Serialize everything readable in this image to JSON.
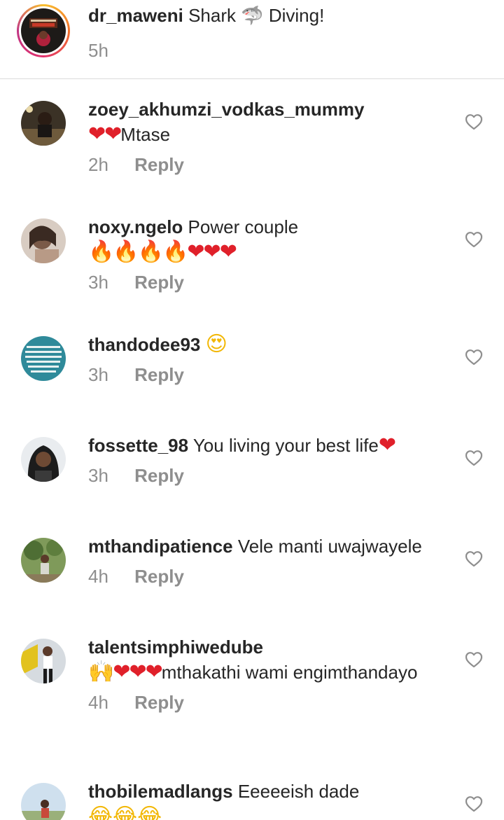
{
  "caption": {
    "username": "dr_maweni",
    "text": "Shark",
    "emoji": "🦈",
    "text2": "Diving!",
    "time": "5h"
  },
  "reply_label": "Reply",
  "comments": [
    {
      "username": "zoey_akhumzi_vodkas_mummy",
      "line1_text": "",
      "line2_emoji": "❤❤",
      "line2_text": "Mtase",
      "time": "2h"
    },
    {
      "username": "noxy.ngelo",
      "line1_text": "Power couple",
      "fire": "🔥🔥🔥🔥",
      "hearts": "❤❤❤",
      "time": "3h"
    },
    {
      "username": "thandodee93",
      "emoji": "😍",
      "time": "3h"
    },
    {
      "username": "fossette_98",
      "text": "You living your best life",
      "emoji": "❤",
      "time": "3h"
    },
    {
      "username": "mthandipatience",
      "text": "Vele manti uwajwayele",
      "time": "4h"
    },
    {
      "username": "talentsimphiwedube",
      "emoji": "🙌❤❤❤",
      "text": "mthakathi wami engimthandayo",
      "time": "4h"
    },
    {
      "username": "thobilemadlangs",
      "text": "Eeeeeish dade",
      "emoji": "😂😂😂"
    }
  ]
}
